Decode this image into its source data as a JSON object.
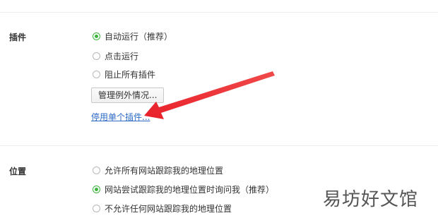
{
  "plugins": {
    "label": "插件",
    "options": [
      {
        "label": "自动运行（推荐）",
        "checked": true
      },
      {
        "label": "点击运行",
        "checked": false
      },
      {
        "label": "阻止所有插件",
        "checked": false
      }
    ],
    "manage_exceptions_button": "管理例外情况...",
    "disable_individual_link": "停用单个插件..."
  },
  "location": {
    "label": "位置",
    "options": [
      {
        "label": "允许所有网站跟踪我的地理位置",
        "checked": false
      },
      {
        "label": "网站尝试跟踪我的地理位置时询问我（推荐）",
        "checked": true
      },
      {
        "label": "不允许任何网站跟踪我的地理位置",
        "checked": false
      }
    ]
  },
  "annotation": {
    "arrow_color": "#e8202a"
  },
  "watermark": "易坊好文馆",
  "colors": {
    "accent_green": "#3db33d",
    "link_blue": "#2c6ac6"
  }
}
